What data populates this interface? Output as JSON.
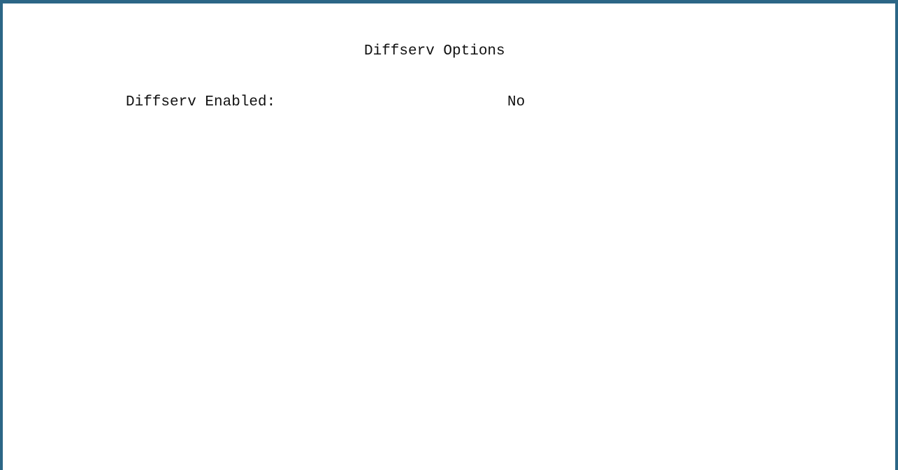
{
  "screen": {
    "title": "Diffserv Options",
    "fields": [
      {
        "label": "Diffserv Enabled:",
        "value": "No"
      }
    ]
  },
  "colors": {
    "border": "#2c6686",
    "background": "#ffffff",
    "text": "#111111"
  }
}
